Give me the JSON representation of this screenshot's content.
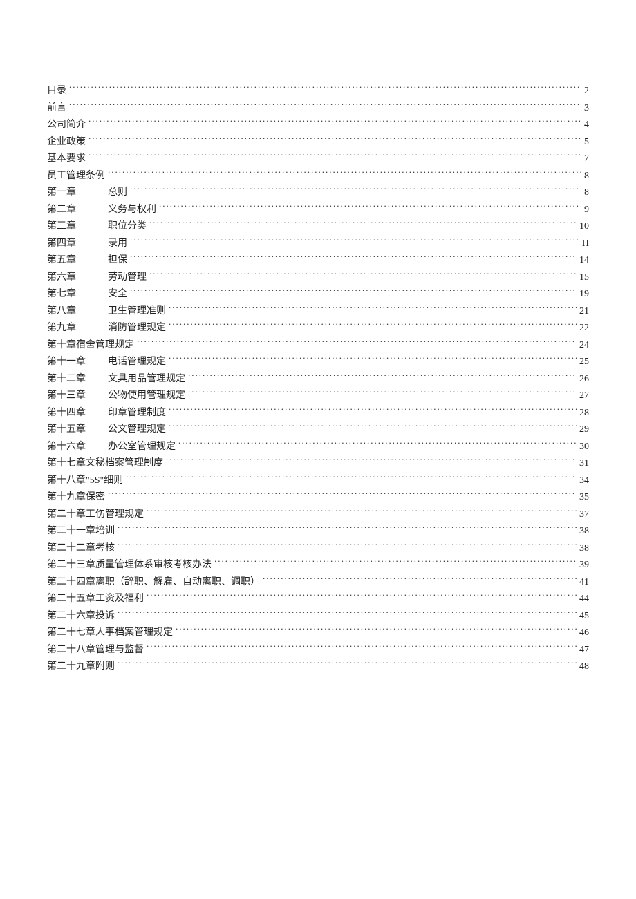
{
  "toc": [
    {
      "chapter": "",
      "title": "目录",
      "page": "2",
      "indent": false,
      "combined": true
    },
    {
      "chapter": "",
      "title": "前言",
      "page": "3",
      "indent": false,
      "combined": true
    },
    {
      "chapter": "",
      "title": "公司简介",
      "page": "4",
      "indent": false,
      "combined": true
    },
    {
      "chapter": "",
      "title": "企业政策",
      "page": "5",
      "indent": false,
      "combined": true
    },
    {
      "chapter": "",
      "title": "基本要求",
      "page": "7",
      "indent": false,
      "combined": true
    },
    {
      "chapter": "",
      "title": "员工管理条例",
      "page": "8",
      "indent": false,
      "combined": true
    },
    {
      "chapter": "第一章",
      "title": "总则",
      "page": "8",
      "indent": true,
      "combined": false
    },
    {
      "chapter": "第二章",
      "title": "义务与权利",
      "page": "9",
      "indent": true,
      "combined": false
    },
    {
      "chapter": "第三章",
      "title": "职位分类",
      "page": "10",
      "indent": true,
      "combined": false
    },
    {
      "chapter": "第四章",
      "title": "录用",
      "page": "H",
      "indent": true,
      "combined": false
    },
    {
      "chapter": "第五章",
      "title": "担保",
      "page": "14",
      "indent": true,
      "combined": false
    },
    {
      "chapter": "第六章",
      "title": "劳动管理",
      "page": "15",
      "indent": true,
      "combined": false
    },
    {
      "chapter": "第七章",
      "title": "安全",
      "page": "19",
      "indent": true,
      "combined": false
    },
    {
      "chapter": "第八章",
      "title": "卫生管理准则",
      "page": "21",
      "indent": true,
      "combined": false
    },
    {
      "chapter": "第九章",
      "title": "消防管理规定",
      "page": "22",
      "indent": true,
      "combined": false
    },
    {
      "chapter": "",
      "title": "第十章宿舍管理规定",
      "page": "24",
      "indent": false,
      "combined": true
    },
    {
      "chapter": "第十一章",
      "title": "电话管理规定",
      "page": "25",
      "indent": true,
      "combined": false
    },
    {
      "chapter": "第十二章",
      "title": "文具用品管理规定",
      "page": "26",
      "indent": true,
      "combined": false
    },
    {
      "chapter": "第十三章",
      "title": "公物使用管理规定",
      "page": "27",
      "indent": true,
      "combined": false
    },
    {
      "chapter": "第十四章",
      "title": "印章管理制度",
      "page": "28",
      "indent": true,
      "combined": false
    },
    {
      "chapter": "第十五章",
      "title": "公文管理规定",
      "page": "29",
      "indent": true,
      "combined": false
    },
    {
      "chapter": "第十六章",
      "title": "办公室管理规定",
      "page": "30",
      "indent": true,
      "combined": false
    },
    {
      "chapter": "",
      "title": "第十七章文秘档案管理制度",
      "page": "31",
      "indent": false,
      "combined": true
    },
    {
      "chapter": "",
      "title": "第十八章\"5S\"细则",
      "page": "34",
      "indent": false,
      "combined": true
    },
    {
      "chapter": "",
      "title": "第十九章保密",
      "page": "35",
      "indent": false,
      "combined": true
    },
    {
      "chapter": "",
      "title": "第二十章工伤管理规定",
      "page": "37",
      "indent": false,
      "combined": true
    },
    {
      "chapter": "",
      "title": "第二十一章培训",
      "page": "38",
      "indent": false,
      "combined": true
    },
    {
      "chapter": "",
      "title": "第二十二章考核",
      "page": "38",
      "indent": false,
      "combined": true
    },
    {
      "chapter": "",
      "title": "第二十三章质量管理体系审核考核办法",
      "page": "39",
      "indent": false,
      "combined": true
    },
    {
      "chapter": "",
      "title": "第二十四章离职（辞职、解雇、自动离职、调职）",
      "page": "41",
      "indent": false,
      "combined": true
    },
    {
      "chapter": "",
      "title": "第二十五章工资及福利",
      "page": "44",
      "indent": false,
      "combined": true
    },
    {
      "chapter": "",
      "title": "第二十六章投诉",
      "page": "45",
      "indent": false,
      "combined": true
    },
    {
      "chapter": "",
      "title": "第二十七章人事档案管理规定",
      "page": "46",
      "indent": false,
      "combined": true
    },
    {
      "chapter": "",
      "title": "第二十八章管理与监督",
      "page": "47",
      "indent": false,
      "combined": true
    },
    {
      "chapter": "",
      "title": "第二十九章附则",
      "page": "48",
      "indent": false,
      "combined": true
    }
  ]
}
